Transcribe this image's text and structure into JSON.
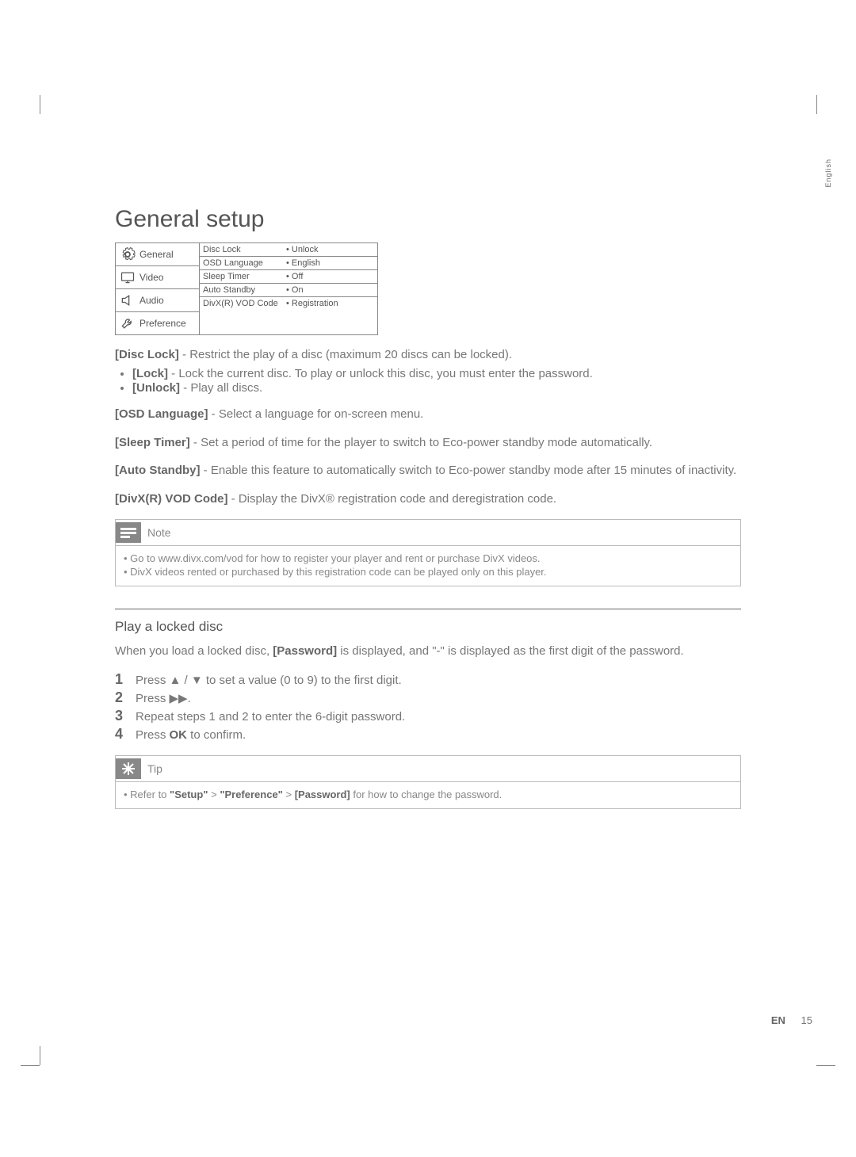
{
  "sideLabel": "English",
  "title": "General setup",
  "menu": {
    "left": [
      "General",
      "Video",
      "Audio",
      "Preference"
    ],
    "rows": [
      {
        "k": "Disc Lock",
        "v": "• Unlock"
      },
      {
        "k": "OSD Language",
        "v": "• English"
      },
      {
        "k": "Sleep Timer",
        "v": "• Off"
      },
      {
        "k": "Auto Standby",
        "v": "• On"
      },
      {
        "k": "DivX(R) VOD Code",
        "v": "• Registration"
      }
    ]
  },
  "discLock": {
    "label": "[Disc Lock]",
    "desc": " - Restrict the play of a disc (maximum 20 discs can be locked).",
    "items": [
      {
        "label": "[Lock]",
        "desc": " - Lock the current disc. To play or unlock this disc, you must enter the password."
      },
      {
        "label": "[Unlock]",
        "desc": " - Play all discs."
      }
    ]
  },
  "osd": {
    "label": "[OSD Language]",
    "desc": " - Select a language for on-screen menu."
  },
  "sleep": {
    "label": "[Sleep Timer]",
    "desc": " - Set a period of time for the player to switch to Eco-power standby mode automatically."
  },
  "auto": {
    "label": "[Auto Standby]",
    "desc": " - Enable this feature to automatically switch to Eco-power standby mode after 15 minutes of inactivity."
  },
  "divx": {
    "label": "[DivX(R) VOD Code]",
    "desc": " - Display the DivX® registration code and deregistration code."
  },
  "noteTitle": "Note",
  "noteItems": [
    "Go to www.divx.com/vod for how to register your player and rent or purchase DivX videos.",
    "DivX videos rented or purchased by this registration code can be played only on this player."
  ],
  "play": {
    "heading": "Play a locked disc",
    "intro_a": "When you load a locked disc, ",
    "intro_b": "[Password]",
    "intro_c": " is displayed, and \"-\" is displayed as the first digit of the password.",
    "steps": [
      {
        "n": "1",
        "t": "Press ▲ / ▼ to set a value (0 to 9) to the first digit."
      },
      {
        "n": "2",
        "t": "Press ▶▶."
      },
      {
        "n": "3",
        "t": "Repeat steps 1 and 2 to enter the 6-digit password."
      },
      {
        "n": "4",
        "pre": "Press ",
        "b": "OK",
        "post": " to confirm."
      }
    ]
  },
  "tipTitle": "Tip",
  "tip": {
    "pre": "Refer to ",
    "a": "\"Setup\"",
    "gt1": " > ",
    "b": "\"Preference\"",
    "gt2": " > ",
    "c": "[Password]",
    "post": " for how to change the password."
  },
  "footer": {
    "lang": "EN",
    "page": "15"
  }
}
